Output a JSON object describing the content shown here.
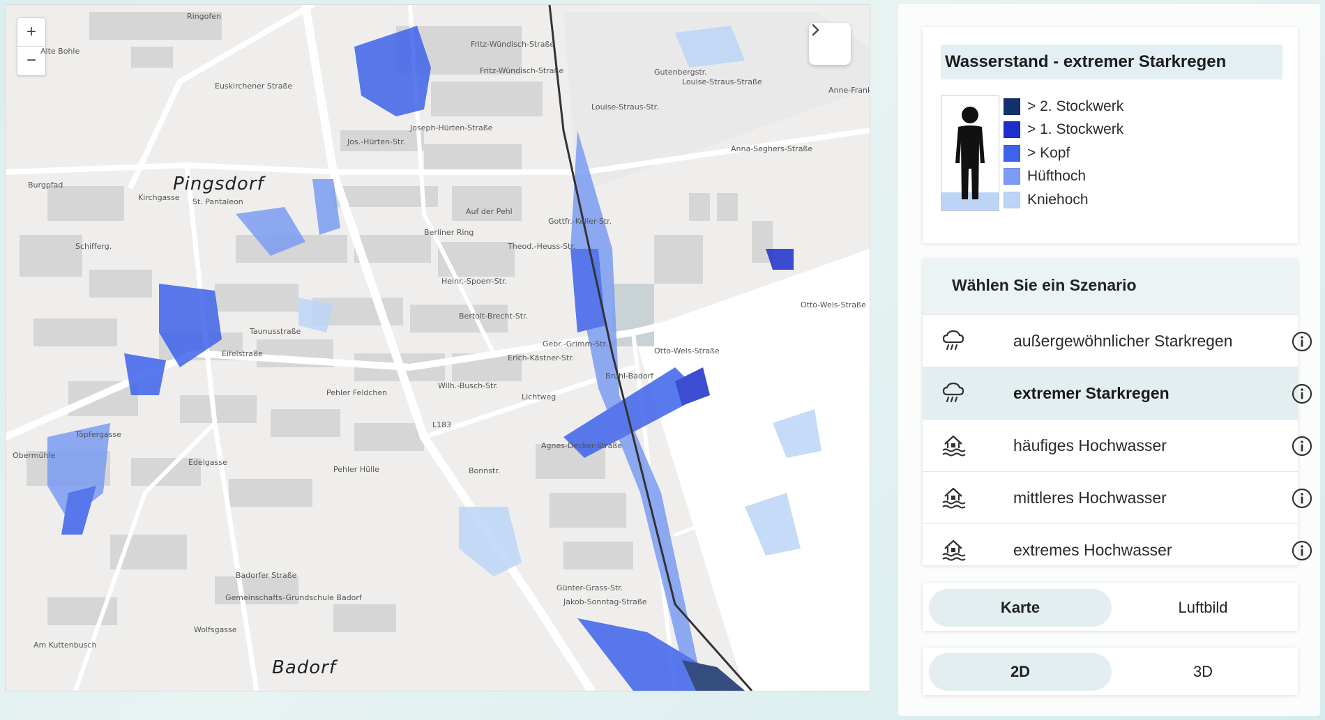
{
  "map": {
    "zoom_in": "+",
    "zoom_out": "−",
    "places": [
      {
        "id": "pingsdorf",
        "label": "Pingsdorf"
      },
      {
        "id": "badorf",
        "label": "Badorf"
      }
    ],
    "streets": [
      "Fritz-Wündisch-Straße",
      "Fritz-Wündisch-Straße",
      "Louise-Straus-Straße",
      "Louise-Straus-Str.",
      "Joseph-Hürten-Straße",
      "Jos.-Hürten-Str.",
      "Burgpfad",
      "Kirchgasse",
      "Euskirchener Straße",
      "Otto-Wels-Straße",
      "Otto-Wels-Straße",
      "Anna-Seghers-Straße",
      "Eifelstraße",
      "Taunusstraße",
      "Pehler Feldchen",
      "Agnes-Decker-Straße",
      "Jakob-Sonntag-Straße",
      "Badorfer Straße",
      "Am Kuttenbusch",
      "Wolfsgasse",
      "Obermühle",
      "Töpfergasse",
      "Edelgasse",
      "Pehler Hülle",
      "Bonnstr.",
      "Berliner Ring",
      "Heinr.-Spoerr-Str.",
      "Auf der Pehl",
      "Theod.-Heuss-Str.",
      "Gottfr.-Keller-Str.",
      "Gebr.-Grimm-Str.",
      "Wilh.-Busch-Str.",
      "Bertolt-Brecht-Str.",
      "Erich-Kästner-Str.",
      "Lichtweg",
      "Bruhl-Badorf",
      "Günter-Grass-Str.",
      "Anne-Frank-Str.",
      "St. Pantaleon",
      "Gemeinschafts-Grundschule Badorf",
      "L183",
      "Ringofen",
      "Alte Bohle",
      "Schifferg.",
      "Gutenbergstr."
    ]
  },
  "legend": {
    "title": "Wasserstand - extremer Starkregen",
    "items": [
      {
        "label": "> 2. Stockwerk",
        "color": "#14306b"
      },
      {
        "label": "> 1. Stockwerk",
        "color": "#1c2fcb"
      },
      {
        "label": "> Kopf",
        "color": "#3d63ea"
      },
      {
        "label": "Hüfthoch",
        "color": "#7b9cf2"
      },
      {
        "label": "Kniehoch",
        "color": "#bcd5f7"
      }
    ]
  },
  "scenarios": {
    "header": "Wählen Sie ein Szenario",
    "items": [
      {
        "label": "außergewöhnlicher Starkregen",
        "icon": "rain-cloud-icon",
        "active": false
      },
      {
        "label": "extremer Starkregen",
        "icon": "rain-cloud-icon",
        "active": true
      },
      {
        "label": "häufiges Hochwasser",
        "icon": "flooded-house-icon",
        "active": false
      },
      {
        "label": "mittleres Hochwasser",
        "icon": "flooded-house-icon",
        "active": false
      },
      {
        "label": "extremes Hochwasser",
        "icon": "flooded-house-icon",
        "active": false
      }
    ]
  },
  "basemap_toggle": {
    "options": [
      "Karte",
      "Luftbild"
    ],
    "active": "Karte"
  },
  "view_toggle": {
    "options": [
      "2D",
      "3D"
    ],
    "active": "2D"
  }
}
